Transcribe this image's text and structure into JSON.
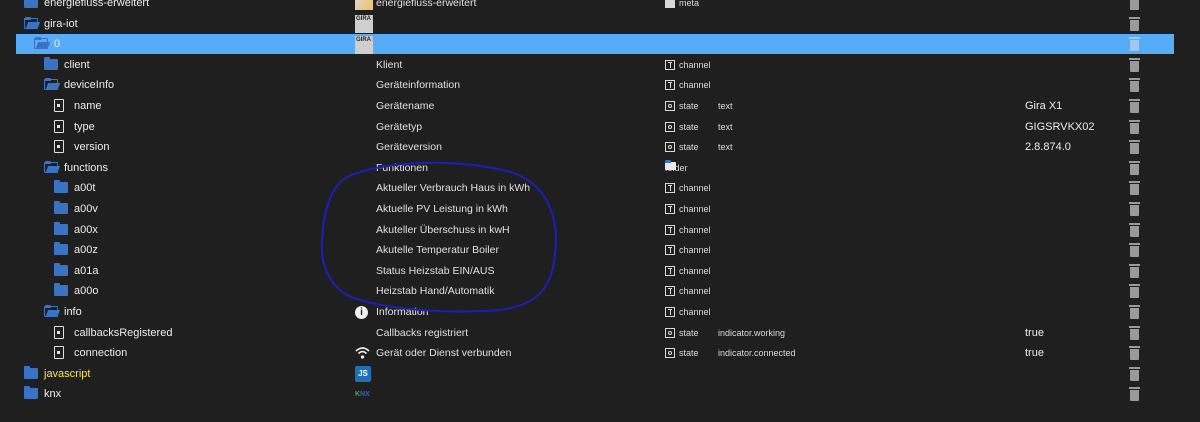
{
  "rows": [
    {
      "name": "energiefluss-erweitert",
      "icon_kind": "folder-closed",
      "indent": 1,
      "desc": "energiefluss-erweitert",
      "type": "meta",
      "role": "",
      "value": "",
      "logo": "energiefluss-logo-icon"
    },
    {
      "name": "gira-iot",
      "icon_kind": "folder-open",
      "indent": 1,
      "desc": "",
      "type": "",
      "role": "",
      "value": "",
      "logo": "gira-logo-icon"
    },
    {
      "name": "0",
      "icon_kind": "folder-open",
      "indent": 2,
      "desc": "",
      "type": "",
      "role": "",
      "value": "",
      "logo": "gira-logo-icon",
      "selected": true
    },
    {
      "name": "client",
      "icon_kind": "folder-closed",
      "indent": 3,
      "desc": "Klient",
      "type": "channel",
      "role": "",
      "value": ""
    },
    {
      "name": "deviceInfo",
      "icon_kind": "folder-open",
      "indent": 3,
      "desc": "Geräteinformation",
      "type": "channel",
      "role": "",
      "value": ""
    },
    {
      "name": "name",
      "icon_kind": "file",
      "indent": 4,
      "desc": "Gerätename",
      "type": "state",
      "role": "text",
      "value": "Gira X1"
    },
    {
      "name": "type",
      "icon_kind": "file",
      "indent": 4,
      "desc": "Gerätetyp",
      "type": "state",
      "role": "text",
      "value": "GIGSRVKX02"
    },
    {
      "name": "version",
      "icon_kind": "file",
      "indent": 4,
      "desc": "Geräteversion",
      "type": "state",
      "role": "text",
      "value": "2.8.874.0"
    },
    {
      "name": "functions",
      "icon_kind": "folder-open",
      "indent": 3,
      "desc": "Funktionen",
      "type": "folder",
      "role": "",
      "value": ""
    },
    {
      "name": "a00t",
      "icon_kind": "folder-closed",
      "indent": 4,
      "desc": "Aktueller Verbrauch Haus in kWh",
      "type": "channel",
      "role": "",
      "value": ""
    },
    {
      "name": "a00v",
      "icon_kind": "folder-closed",
      "indent": 4,
      "desc": "Aktuelle PV Leistung in kWh",
      "type": "channel",
      "role": "",
      "value": ""
    },
    {
      "name": "a00x",
      "icon_kind": "folder-closed",
      "indent": 4,
      "desc": "Akuteller Überschuss in kwH",
      "type": "channel",
      "role": "",
      "value": ""
    },
    {
      "name": "a00z",
      "icon_kind": "folder-closed",
      "indent": 4,
      "desc": "Akutelle Temperatur Boiler",
      "type": "channel",
      "role": "",
      "value": ""
    },
    {
      "name": "a01a",
      "icon_kind": "folder-closed",
      "indent": 4,
      "desc": "Status Heizstab EIN/AUS",
      "type": "channel",
      "role": "",
      "value": ""
    },
    {
      "name": "a00o",
      "icon_kind": "folder-closed",
      "indent": 4,
      "desc": "Heizstab Hand/Automatik",
      "type": "channel",
      "role": "",
      "value": ""
    },
    {
      "name": "info",
      "icon_kind": "folder-open",
      "indent": 3,
      "desc": "Information",
      "type": "channel",
      "role": "",
      "value": "",
      "logo": "info-icon"
    },
    {
      "name": "callbacksRegistered",
      "icon_kind": "file",
      "indent": 4,
      "desc": "Callbacks registriert",
      "type": "state",
      "role": "indicator.working",
      "value": "true"
    },
    {
      "name": "connection",
      "icon_kind": "file",
      "indent": 4,
      "desc": "Gerät oder Dienst verbunden",
      "type": "state",
      "role": "indicator.connected",
      "value": "true",
      "logo": "wifi-icon"
    },
    {
      "name": "javascript",
      "icon_kind": "folder-closed",
      "indent": 1,
      "desc": "",
      "type": "",
      "role": "",
      "value": "",
      "logo": "javascript-logo-icon",
      "yellow": true
    },
    {
      "name": "knx",
      "icon_kind": "folder-closed",
      "indent": 1,
      "desc": "",
      "type": "",
      "role": "",
      "value": "",
      "logo": "knx-logo-icon"
    }
  ],
  "logo_text": {
    "gira": "GIRA IoT",
    "js": "JS",
    "knx_k": "K",
    "knx_nx": "NX",
    "info": "i"
  },
  "colors": {
    "background": "#1f1f1f",
    "selection": "#57acf8",
    "folder": "#3a73c4",
    "annotation": "#1d1fb8"
  }
}
